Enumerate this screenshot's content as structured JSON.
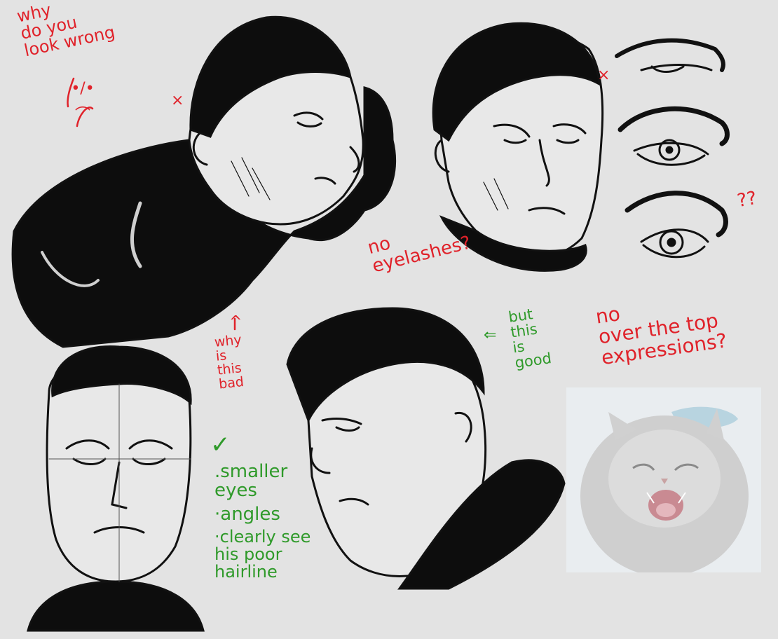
{
  "colors": {
    "background": "#e3e3e3",
    "ink": "#111111",
    "red_note": "#e0222a",
    "green_note": "#2f9a2a",
    "photo_bg": "#e9edf0"
  },
  "notes": {
    "why_wrong": "why\ndo you\nlook wrong",
    "no_eyelashes": "no\neyelashes?",
    "question_marks": "??",
    "why_bad": "why\nis\nthis\nbad",
    "but_good": "but\nthis\nis\ngood",
    "no_over_top": "no\nover the top\nexpressions?",
    "checklist": [
      ".smaller\n eyes",
      "·angles",
      "·clearly see\n his poor\n hairline"
    ],
    "x_mark_1": "×",
    "x_mark_2": "×",
    "arrow_up": "^",
    "arrow_left": "⇐",
    "checkmark": "✓",
    "frown_face": "•/•\n︵"
  },
  "photo": {
    "subject": "cat-yawning-photo"
  }
}
